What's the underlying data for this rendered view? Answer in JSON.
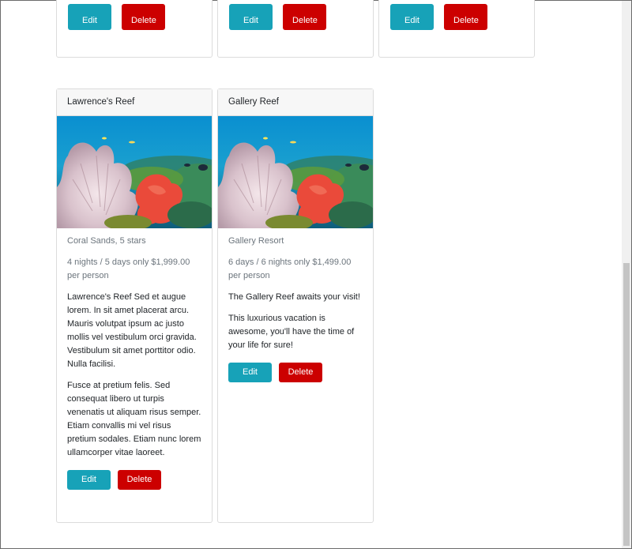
{
  "top_cards": [
    {
      "edit_label": "Edit",
      "delete_label": "Delete"
    },
    {
      "edit_label": "Edit",
      "delete_label": "Delete"
    },
    {
      "edit_label": "Edit",
      "delete_label": "Delete"
    }
  ],
  "cards": [
    {
      "title": "Lawrence's Reef",
      "image_icon": "coral-reef-image",
      "subtitle": "Coral Sands, 5 stars",
      "price": "4 nights / 5 days only $1,999.00 per person",
      "paragraphs": [
        "Lawrence's Reef Sed et augue lorem. In sit amet placerat arcu. Mauris volutpat ipsum ac justo mollis vel vestibulum orci gravida. Vestibulum sit amet porttitor odio. Nulla facilisi.",
        "Fusce at pretium felis. Sed consequat libero ut turpis venenatis ut aliquam risus semper. Etiam convallis mi vel risus pretium sodales. Etiam nunc lorem ullamcorper vitae laoreet."
      ],
      "edit_label": "Edit",
      "delete_label": "Delete"
    },
    {
      "title": "Gallery Reef",
      "image_icon": "coral-reef-image",
      "subtitle": "Gallery Resort",
      "price": "6 days / 6 nights only $1,499.00 per person",
      "paragraphs": [
        "The Gallery Reef awaits your visit!",
        "This luxurious vacation is awesome, you'll have the time of your life for sure!"
      ],
      "edit_label": "Edit",
      "delete_label": "Delete"
    }
  ],
  "colors": {
    "edit_button": "#17a2b8",
    "delete_button": "#cc0000",
    "card_header_bg": "#f7f7f7"
  }
}
